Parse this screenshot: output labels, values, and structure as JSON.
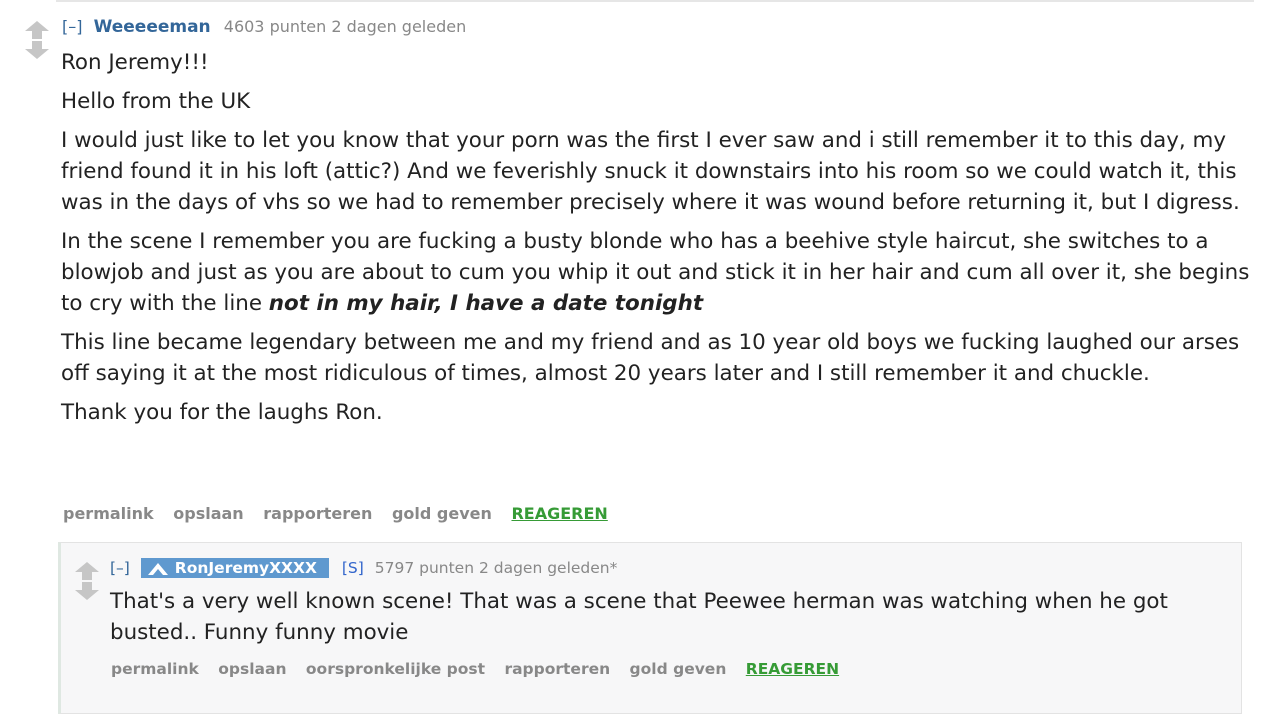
{
  "comment1": {
    "expand": "[–]",
    "author": "Weeeeeman",
    "score_time": "4603 punten 2 dagen geleden",
    "paragraphs": [
      "Ron Jeremy!!!",
      "Hello from the UK",
      "I would just like to let you know that your porn was the first I ever saw and i still remember it to this day, my friend found it in his loft (attic?) And we feverishly snuck it downstairs into his room so we could watch it, this was in the days of vhs so we had to remember precisely where it was wound before returning it, but I digress."
    ],
    "scene_text": "In the scene I remember you are fucking a busty blonde who has a beehive style haircut, she switches to a blowjob and just as you are about to cum you whip it out and stick it in her hair and cum all over it, she begins to cry with the line ",
    "scene_quote": "not in my hair, I have a date tonight",
    "paragraph_legend": "This line became legendary between me and my friend and as 10 year old boys we fucking laughed our arses off saying it at the most ridiculous of times, almost 20 years later and I still remember it and chuckle.",
    "paragraph_thanks": "Thank you for the laughs Ron.",
    "buttons": {
      "permalink": "permalink",
      "save": "opslaan",
      "report": "rapporteren",
      "gold": "gold geven",
      "reply": "REAGEREN"
    }
  },
  "comment2": {
    "expand": "[–]",
    "author": "RonJeremyXXXX",
    "submitter": "[S]",
    "score_time": "5797 punten 2 dagen geleden*",
    "body": "That's a very well known scene! That was a scene that Peewee herman was watching when he got busted.. Funny funny movie",
    "buttons": {
      "permalink": "permalink",
      "save": "opslaan",
      "parent": "oorspronkelijke post",
      "report": "rapporteren",
      "gold": "gold geven",
      "reply": "REAGEREN"
    }
  },
  "icons": {
    "upvote": "upvote-arrow-icon",
    "downvote": "downvote-arrow-icon",
    "verified": "verified-flair-icon"
  },
  "colors": {
    "author": "#336699",
    "meta": "#888888",
    "reply": "#369b36",
    "flair": "#5f99cf"
  }
}
